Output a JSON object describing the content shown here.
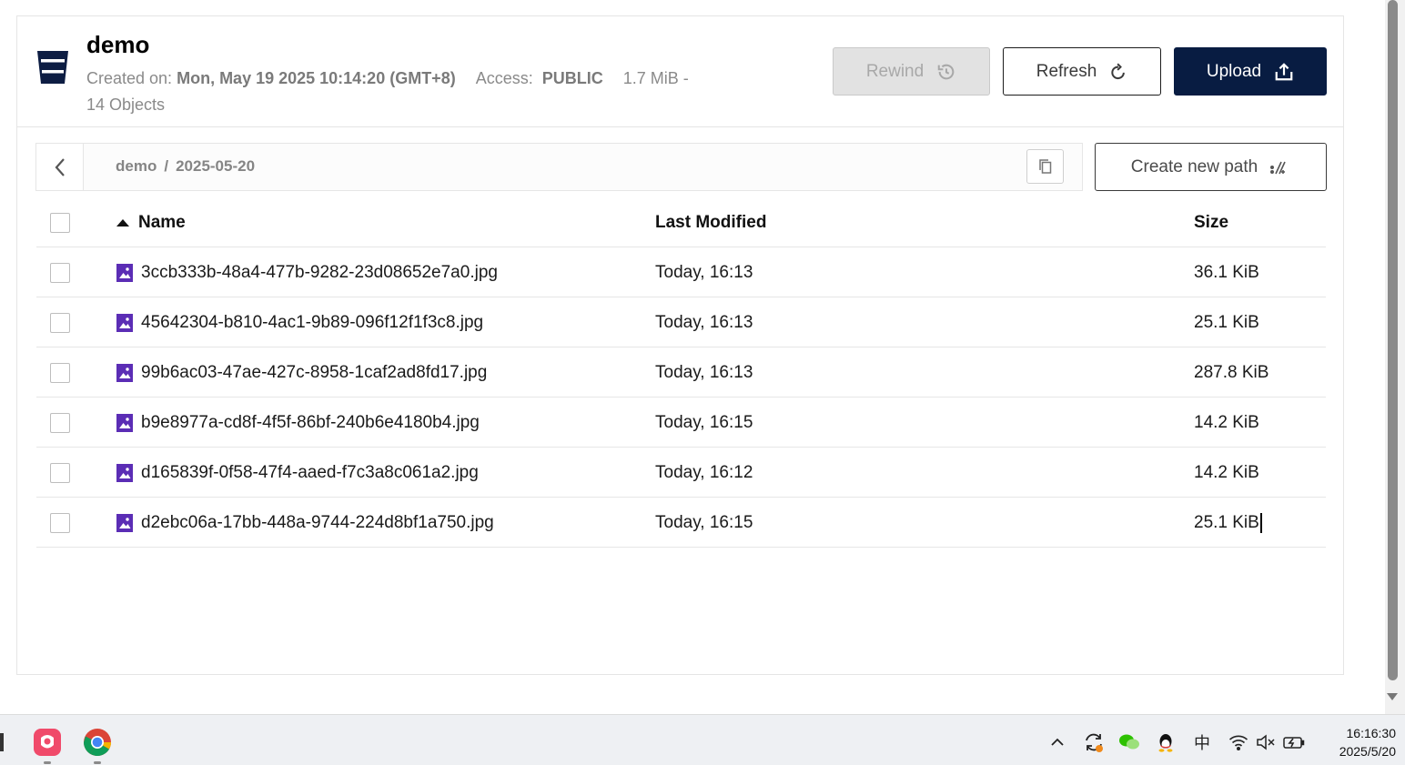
{
  "bucket": {
    "name": "demo",
    "created_label": "Created on:",
    "created_value": "Mon, May 19 2025 10:14:20 (GMT+8)",
    "access_label": "Access:",
    "access_value": "PUBLIC",
    "size_summary": "1.7 MiB -",
    "objects_summary": "14 Objects"
  },
  "actions": {
    "rewind_label": "Rewind",
    "refresh_label": "Refresh",
    "upload_label": "Upload",
    "create_path_label": "Create new path"
  },
  "breadcrumb": {
    "root": "demo",
    "separator": "/",
    "current": "2025-05-20"
  },
  "table": {
    "columns": {
      "name": "Name",
      "modified": "Last Modified",
      "size": "Size"
    },
    "rows": [
      {
        "name": "3ccb333b-48a4-477b-9282-23d08652e7a0.jpg",
        "modified": "Today, 16:13",
        "size": "36.1 KiB"
      },
      {
        "name": "45642304-b810-4ac1-9b89-096f12f1f3c8.jpg",
        "modified": "Today, 16:13",
        "size": "25.1 KiB"
      },
      {
        "name": "99b6ac03-47ae-427c-8958-1caf2ad8fd17.jpg",
        "modified": "Today, 16:13",
        "size": "287.8 KiB"
      },
      {
        "name": "b9e8977a-cd8f-4f5f-86bf-240b6e4180b4.jpg",
        "modified": "Today, 16:15",
        "size": "14.2 KiB"
      },
      {
        "name": "d165839f-0f58-47f4-aaed-f7c3a8c061a2.jpg",
        "modified": "Today, 16:12",
        "size": "14.2 KiB"
      },
      {
        "name": "d2ebc06a-17bb-448a-9744-224d8bf1a750.jpg",
        "modified": "Today, 16:15",
        "size": "25.1 KiB"
      }
    ]
  },
  "taskbar": {
    "ime_label": "中",
    "time": "16:16:30",
    "date": "2025/5/20"
  },
  "colors": {
    "upload_bg": "#081c42",
    "file_icon": "#5b2db5",
    "bucket_icon": "#0d1d43"
  },
  "icons": {
    "bucket": "bucket-icon",
    "rewind": "history-icon",
    "refresh": "refresh-icon",
    "upload": "upload-icon",
    "back": "chevron-left-icon",
    "copy": "copy-icon",
    "create_path": "new-path-icon",
    "sort": "sort-ascending-icon",
    "file": "image-file-icon"
  }
}
